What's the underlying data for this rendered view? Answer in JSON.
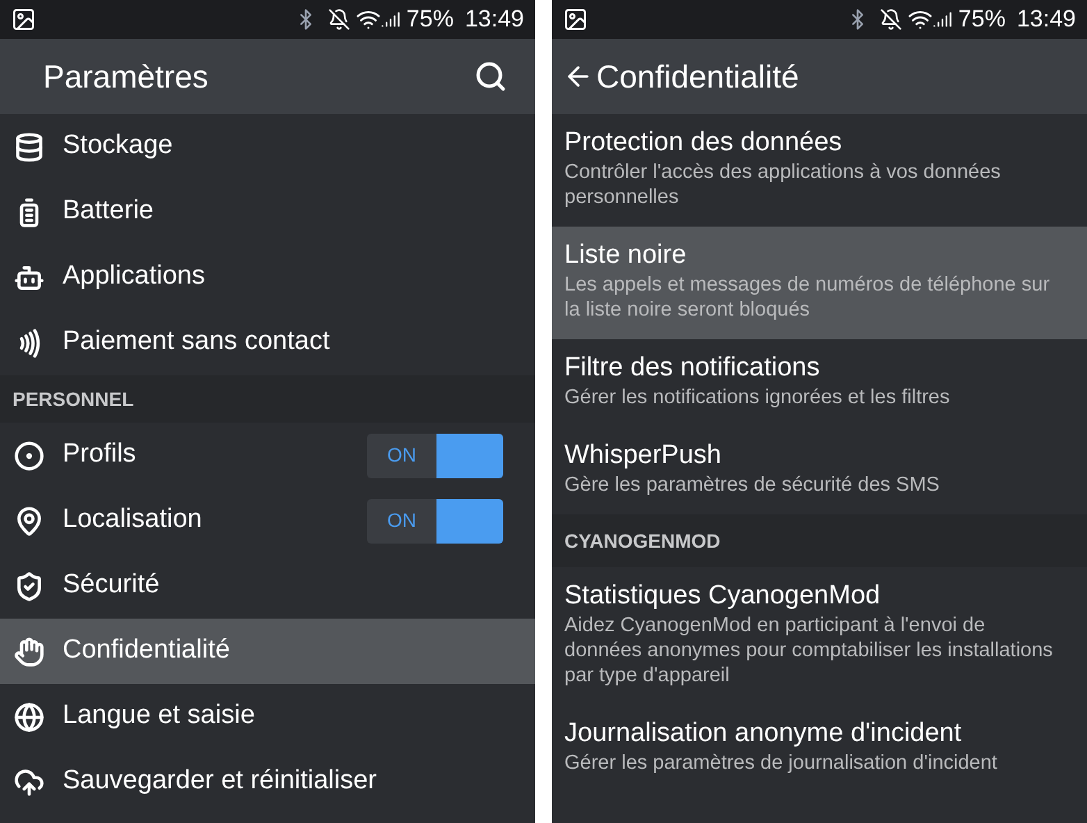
{
  "settings_screen": {
    "status_bar": {
      "battery": "75%",
      "time": "13:49"
    },
    "toolbar": {
      "title": "Paramètres"
    },
    "items": [
      {
        "kind": "item",
        "label": "Stockage",
        "selected": false
      },
      {
        "kind": "item",
        "label": "Batterie",
        "selected": false
      },
      {
        "kind": "item",
        "label": "Applications",
        "selected": false
      },
      {
        "kind": "item",
        "label": "Paiement sans contact",
        "selected": false
      },
      {
        "kind": "header",
        "label": "PERSONNEL"
      },
      {
        "kind": "item",
        "label": "Profils",
        "selected": false,
        "toggle": {
          "label": "ON",
          "on": true
        }
      },
      {
        "kind": "item",
        "label": "Localisation",
        "selected": false,
        "toggle": {
          "label": "ON",
          "on": true
        }
      },
      {
        "kind": "item",
        "label": "Sécurité",
        "selected": false
      },
      {
        "kind": "item",
        "label": "Confidentialité",
        "selected": true
      },
      {
        "kind": "item",
        "label": "Langue et saisie",
        "selected": false
      },
      {
        "kind": "item",
        "label": "Sauvegarder et réinitialiser",
        "selected": false
      }
    ]
  },
  "privacy_screen": {
    "status_bar": {
      "battery": "75%",
      "time": "13:49"
    },
    "toolbar": {
      "title": "Confidentialité"
    },
    "items": [
      {
        "kind": "item",
        "title": "Protection des données",
        "summary": "Contrôler l'accès des applications à vos données personnelles",
        "selected": false
      },
      {
        "kind": "item",
        "title": "Liste noire",
        "summary": "Les appels et messages de numéros de téléphone sur la liste noire seront bloqués",
        "selected": true
      },
      {
        "kind": "item",
        "title": "Filtre des notifications",
        "summary": "Gérer les notifications ignorées et les filtres",
        "selected": false
      },
      {
        "kind": "item",
        "title": "WhisperPush",
        "summary": "Gère les paramètres de sécurité des SMS",
        "selected": false
      },
      {
        "kind": "header",
        "title": "CYANOGENMOD"
      },
      {
        "kind": "item",
        "title": "Statistiques CyanogenMod",
        "summary": "Aidez CyanogenMod en participant à l'envoi de données anonymes pour comptabiliser les installations par type d'appareil",
        "selected": false
      },
      {
        "kind": "item",
        "title": "Journalisation anonyme d'incident",
        "summary": "Gérer les paramètres de journalisation d'incident",
        "selected": false
      }
    ]
  }
}
